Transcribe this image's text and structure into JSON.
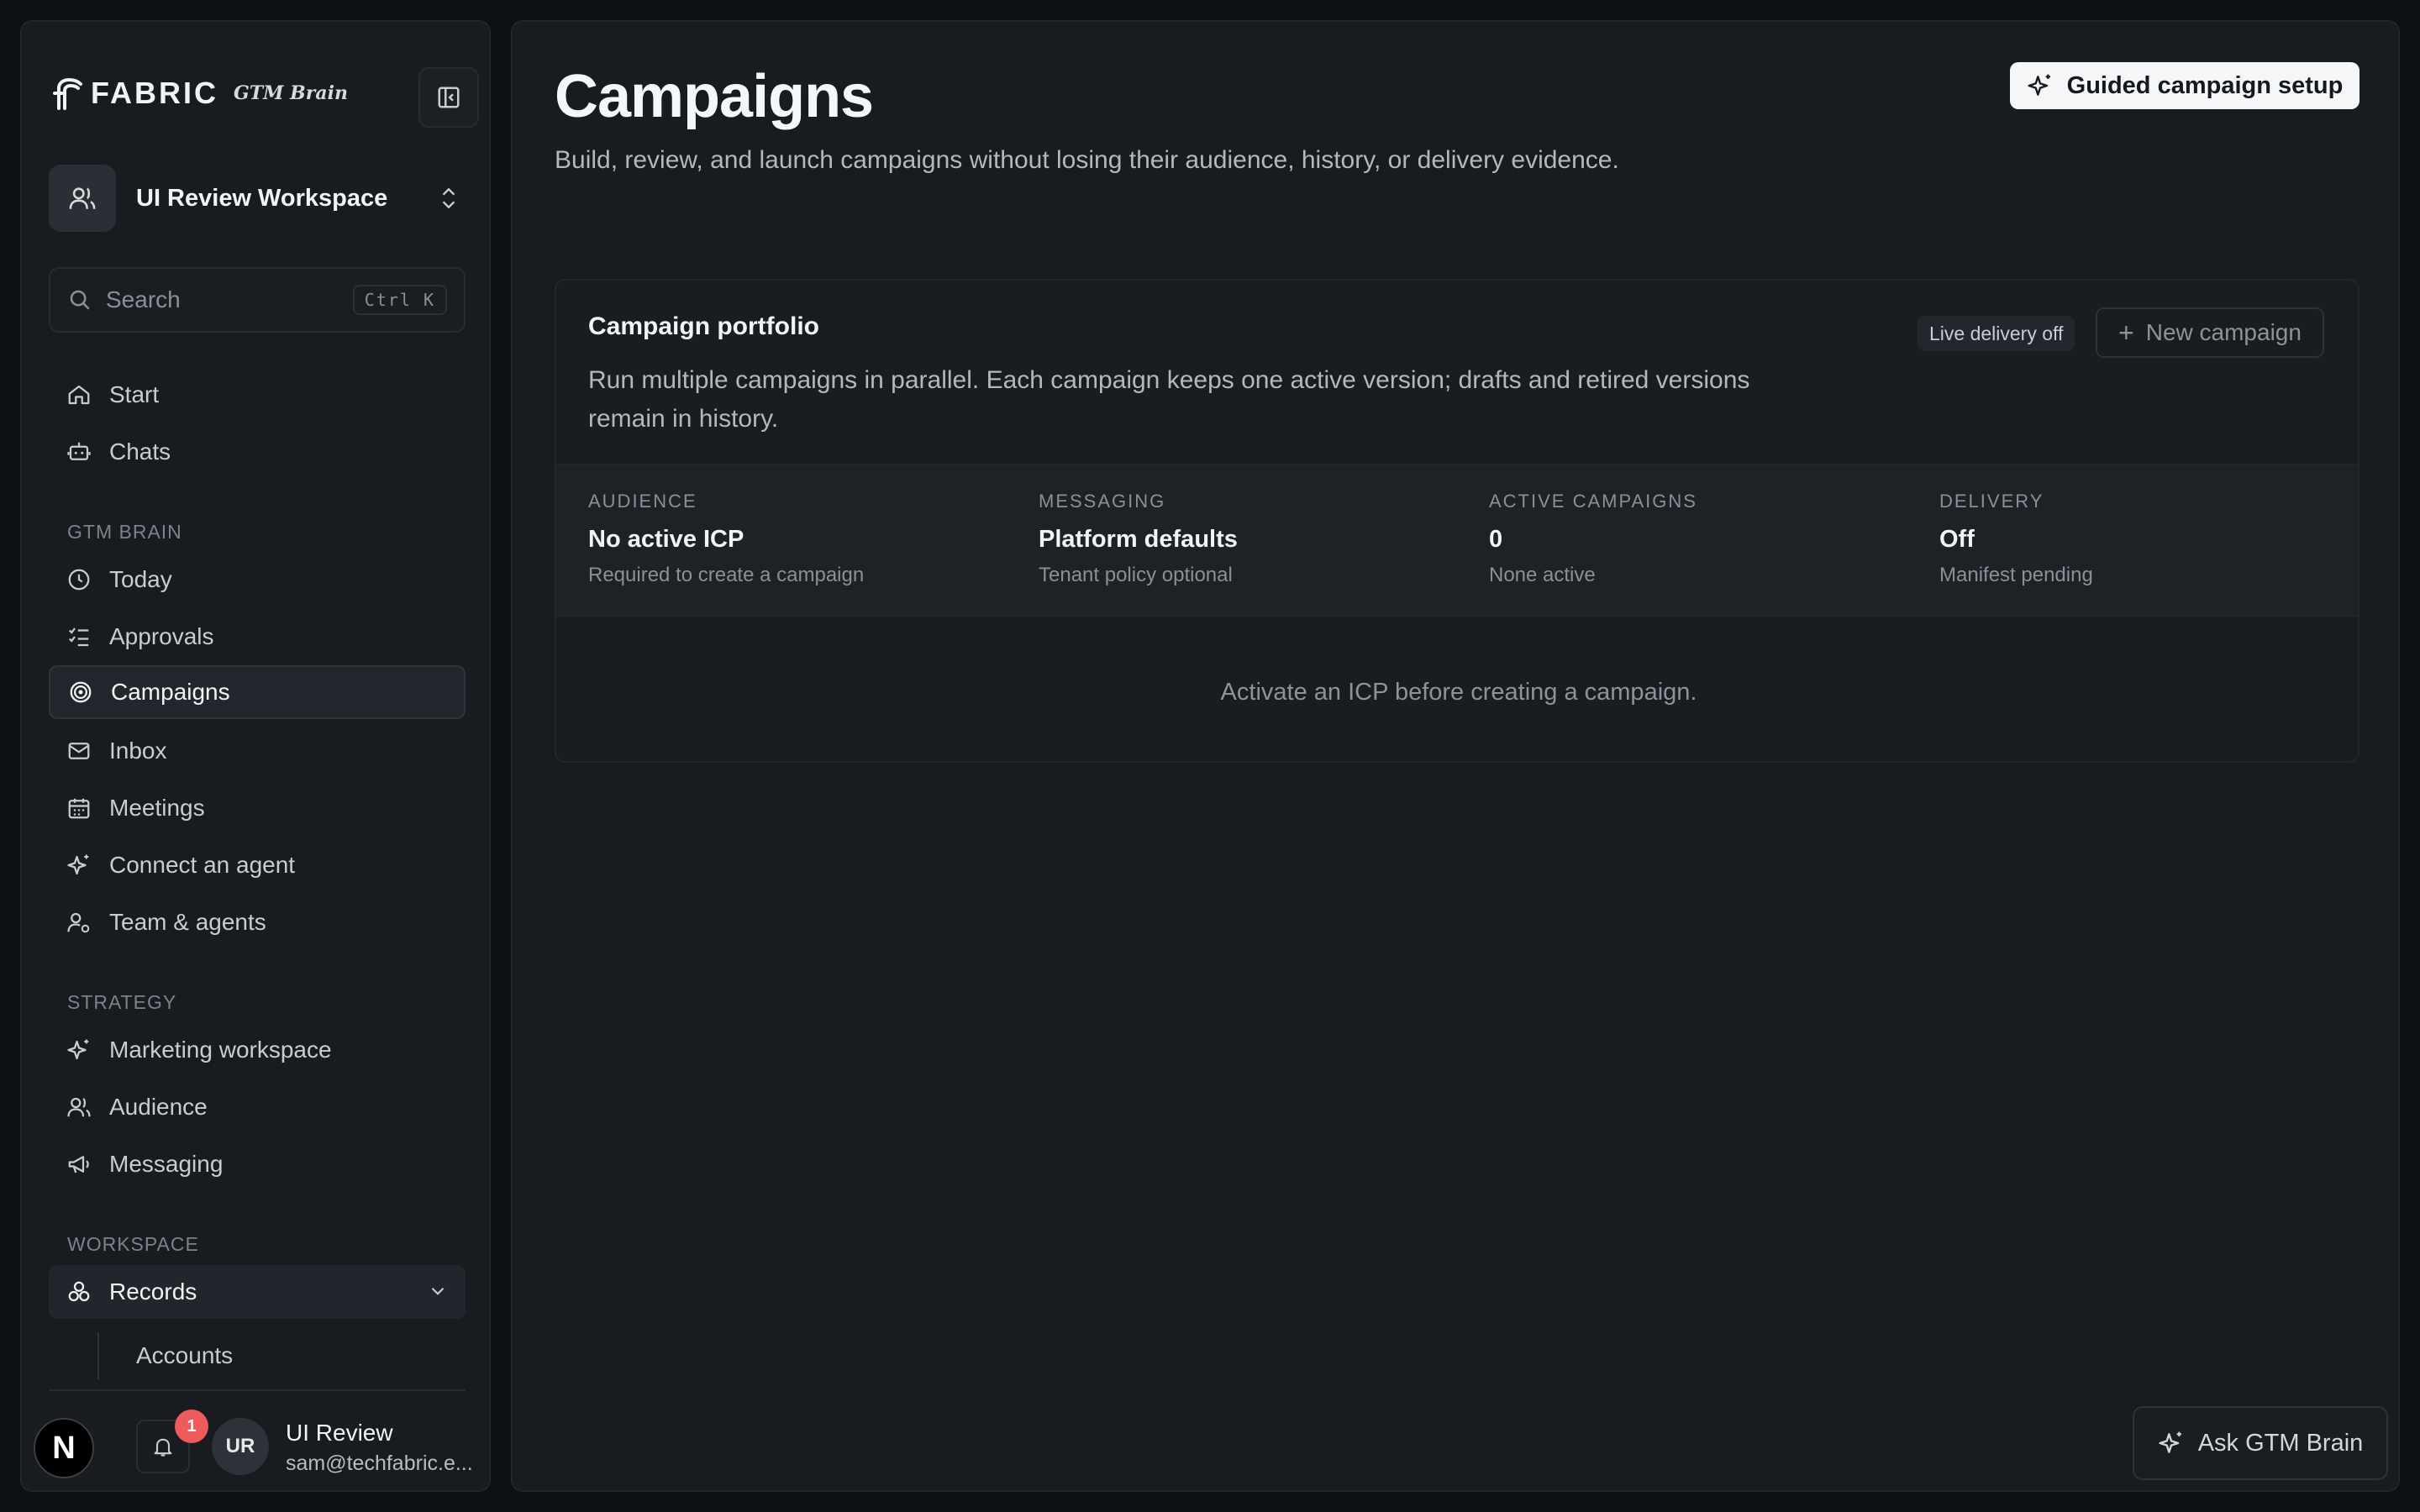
{
  "brand": {
    "name": "FABRIC",
    "sub": "GTM Brain"
  },
  "workspace": {
    "name": "UI Review Workspace"
  },
  "search": {
    "placeholder": "Search",
    "shortcut": "Ctrl K"
  },
  "nav_top": [
    {
      "label": "Start",
      "icon": "home-icon"
    },
    {
      "label": "Chats",
      "icon": "chat-bot-icon"
    }
  ],
  "sections": {
    "gtm_brain": "GTM BRAIN",
    "strategy": "STRATEGY",
    "workspace": "WORKSPACE"
  },
  "nav_gtm": [
    {
      "label": "Today",
      "icon": "clock-icon"
    },
    {
      "label": "Approvals",
      "icon": "checklist-icon"
    },
    {
      "label": "Campaigns",
      "icon": "target-icon",
      "active": true
    },
    {
      "label": "Inbox",
      "icon": "mail-icon"
    },
    {
      "label": "Meetings",
      "icon": "calendar-icon"
    },
    {
      "label": "Connect an agent",
      "icon": "sparkles-icon"
    },
    {
      "label": "Team & agents",
      "icon": "user-gear-icon"
    }
  ],
  "nav_strategy": [
    {
      "label": "Marketing workspace",
      "icon": "sparkles-icon"
    },
    {
      "label": "Audience",
      "icon": "users-icon"
    },
    {
      "label": "Messaging",
      "icon": "megaphone-icon"
    }
  ],
  "nav_workspace": {
    "records": {
      "label": "Records",
      "icon": "records-icon"
    },
    "accounts": "Accounts"
  },
  "notifications": {
    "count": "1"
  },
  "user": {
    "initials": "UR",
    "name": "UI Review",
    "email": "sam@techfabric.e..."
  },
  "dev_badge": "N",
  "page": {
    "title": "Campaigns",
    "subtitle": "Build, review, and launch campaigns without losing their audience, history, or delivery evidence.",
    "guided_button": "Guided campaign setup"
  },
  "portfolio": {
    "title": "Campaign portfolio",
    "description": "Run multiple campaigns in parallel. Each campaign keeps one active version; drafts and retired versions remain in history.",
    "live_badge": "Live delivery off",
    "new_button": "New campaign",
    "stats": [
      {
        "label": "AUDIENCE",
        "value": "No active ICP",
        "note": "Required to create a campaign"
      },
      {
        "label": "MESSAGING",
        "value": "Platform defaults",
        "note": "Tenant policy optional"
      },
      {
        "label": "ACTIVE CAMPAIGNS",
        "value": "0",
        "note": "None active"
      },
      {
        "label": "DELIVERY",
        "value": "Off",
        "note": "Manifest pending"
      }
    ],
    "empty_message": "Activate an ICP before creating a campaign."
  },
  "ask_button": "Ask GTM Brain",
  "colors": {
    "background": "#0d1014",
    "panel": "#181b20",
    "accent_badge": "#ef5b5b"
  }
}
